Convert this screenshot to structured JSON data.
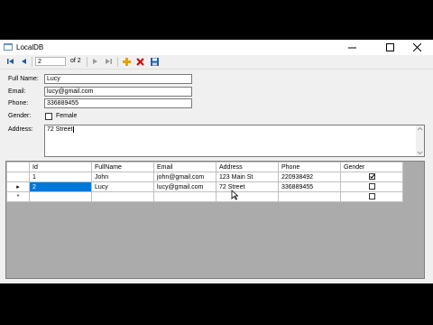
{
  "window": {
    "title": "LocalDB"
  },
  "toolbar": {
    "position": "2",
    "count": "of 2"
  },
  "form": {
    "fullname_label": "Full Name:",
    "fullname_value": "Lucy",
    "email_label": "Email:",
    "email_value": "lucy@gmail.com",
    "phone_label": "Phone:",
    "phone_value": "336889455",
    "gender_label": "Gender:",
    "female_label": "Female",
    "female_checked": false,
    "address_label": "Address:",
    "address_value": "72 Street"
  },
  "grid": {
    "columns": [
      "Id",
      "FullName",
      "Email",
      "Address",
      "Phone",
      "Gender"
    ],
    "rows": [
      {
        "id": "1",
        "fullname": "John",
        "email": "john@gmail.com",
        "address": "123 Main St",
        "phone": "220938492",
        "gender_checked": true
      },
      {
        "id": "2",
        "fullname": "Lucy",
        "email": "lucy@gmail.com",
        "address": "72 Street",
        "phone": "336889455",
        "gender_checked": false
      }
    ],
    "new_row_marker": "*",
    "current_row_marker": "▸"
  },
  "colors": {
    "selection": "#0078d7",
    "grid_background": "#ababab",
    "add_icon": "#e8a000",
    "delete_icon": "#d00000",
    "save_icon": "#1f5fbf"
  }
}
